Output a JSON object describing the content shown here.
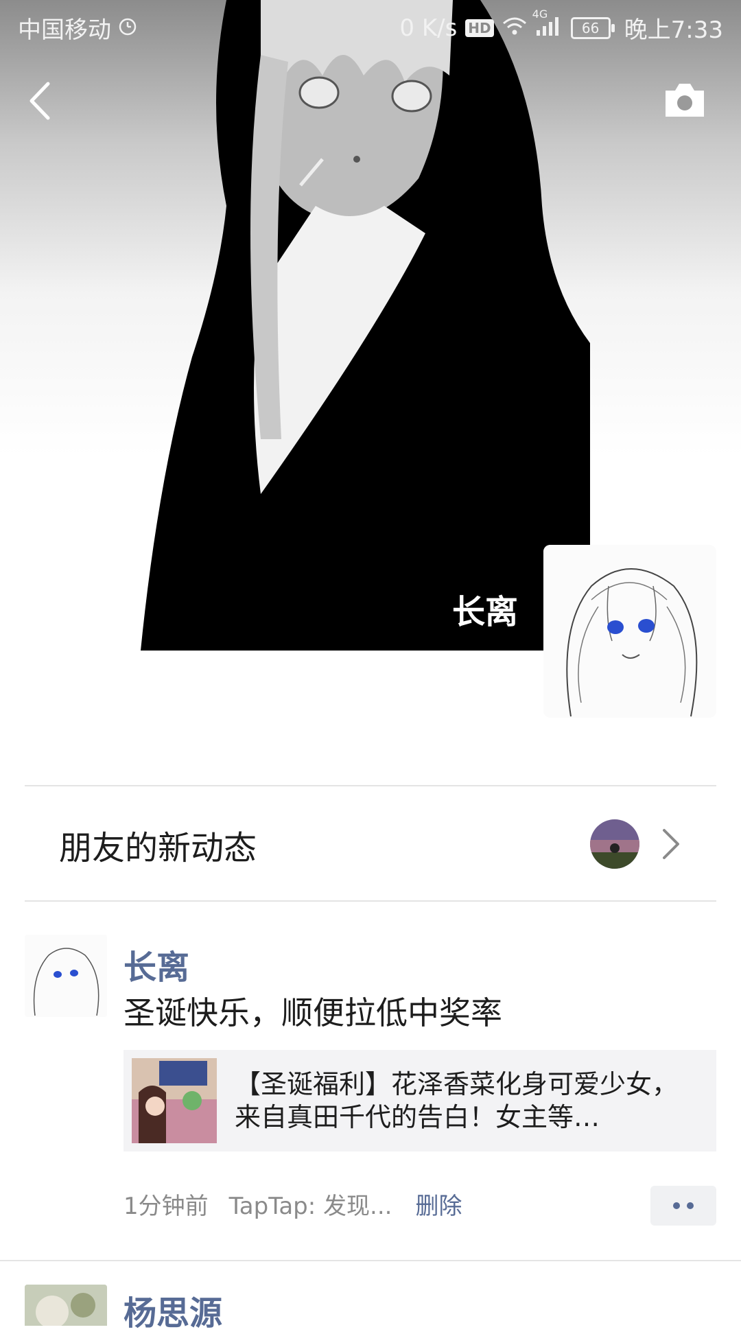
{
  "status_bar": {
    "carrier": "中国移动",
    "speed": "0 K/s",
    "hd": "HD",
    "network": "4G",
    "battery": "66",
    "time": "晚上7:33"
  },
  "profile": {
    "name": "长离"
  },
  "friends_updates": {
    "label": "朋友的新动态"
  },
  "posts": [
    {
      "author": "长离",
      "text": "圣诞快乐，顺便拉低中奖率",
      "link_title": "【圣诞福利】花泽香菜化身可爱少女，来自真田千代的告白！女主等…",
      "time": "1分钟前",
      "source": "TapTap: 发现...",
      "delete_label": "删除"
    },
    {
      "author": "杨思源"
    }
  ],
  "colors": {
    "link_blue": "#576b95",
    "divider": "#e4e4e4",
    "card_bg": "#f3f3f5"
  },
  "icons": {
    "back": "back-arrow-icon",
    "camera": "camera-icon",
    "chevron": "chevron-right-icon",
    "more": "more-dots-icon"
  }
}
